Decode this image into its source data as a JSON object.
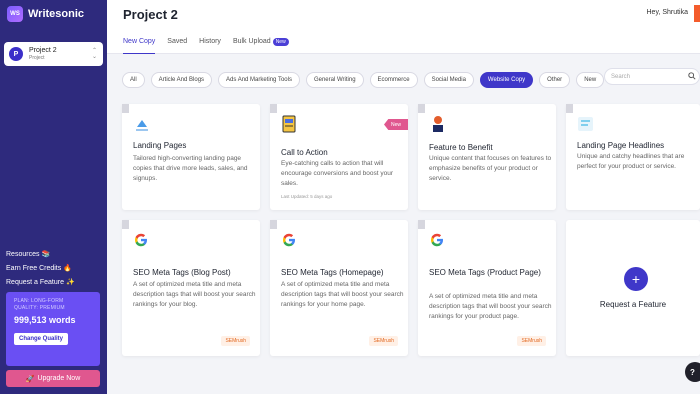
{
  "app": {
    "logo_mark": "WS",
    "name": "Writesonic"
  },
  "project": {
    "avatar": "P",
    "name": "Project 2",
    "subtitle": "Project"
  },
  "sidebar": {
    "links": [
      {
        "label": "Resources",
        "emoji": "📚"
      },
      {
        "label": "Earn Free Credits",
        "emoji": "🔥"
      },
      {
        "label": "Request a Feature",
        "emoji": "✨"
      }
    ],
    "plan": {
      "line1": "PLAN: LONG-FORM",
      "line2": "QUALITY: PREMIUM",
      "words": "999,513 words",
      "change_label": "Change Quality"
    },
    "upgrade": {
      "label": "Upgrade Now",
      "icon": "rocket-icon"
    }
  },
  "header": {
    "title": "Project 2",
    "greeting": "Hey, Shrutika",
    "tabs": [
      {
        "label": "New Copy",
        "active": true
      },
      {
        "label": "Saved"
      },
      {
        "label": "History"
      },
      {
        "label": "Bulk Upload",
        "badge": "New"
      }
    ]
  },
  "filters": {
    "chips": [
      "All",
      "Article And Blogs",
      "Ads And Marketing Tools",
      "General Writing",
      "Ecommerce",
      "Social Media",
      "Website Copy",
      "Other",
      "New"
    ],
    "active": "Website Copy",
    "search_placeholder": "Search"
  },
  "cards": [
    {
      "title": "Landing Pages",
      "desc": "Tailored high-converting landing page copies that drive more leads, sales, and signups.",
      "icon": "landing-icon"
    },
    {
      "title": "Call to Action",
      "desc": "Eye-catching calls to action that will encourage conversions and boost your sales.",
      "meta": "Last Updated: 5 days ago",
      "ribbon": "New",
      "icon": "cta-icon"
    },
    {
      "title": "Feature to Benefit",
      "desc": "Unique content that focuses on features to emphasize benefits of your product or service.",
      "icon": "feature-icon"
    },
    {
      "title": "Landing Page Headlines",
      "desc": "Unique and catchy headlines that are perfect for your product or service.",
      "icon": "headline-icon"
    },
    {
      "title": "SEO Meta Tags (Blog Post)",
      "desc": "A set of optimized meta title and meta description tags that will boost your search rankings for your blog.",
      "badge": "SEMrush",
      "icon": "google-icon"
    },
    {
      "title": "SEO Meta Tags (Homepage)",
      "desc": "A set of optimized meta title and meta description tags that will boost your search rankings for your home page.",
      "badge": "SEMrush",
      "icon": "google-icon"
    },
    {
      "title": "SEO Meta Tags (Product Page)",
      "desc": "A set of optimized meta title and meta description tags that will boost your search rankings for your product page.",
      "badge": "SEMrush",
      "icon": "google-icon"
    }
  ],
  "request_card": {
    "plus": "+",
    "label": "Request a Feature"
  },
  "help": {
    "label": "?"
  },
  "colors": {
    "sidebar": "#2e2a7d",
    "accent": "#3f37c9",
    "pink": "#e0578f",
    "semrush": "#e2671f"
  }
}
